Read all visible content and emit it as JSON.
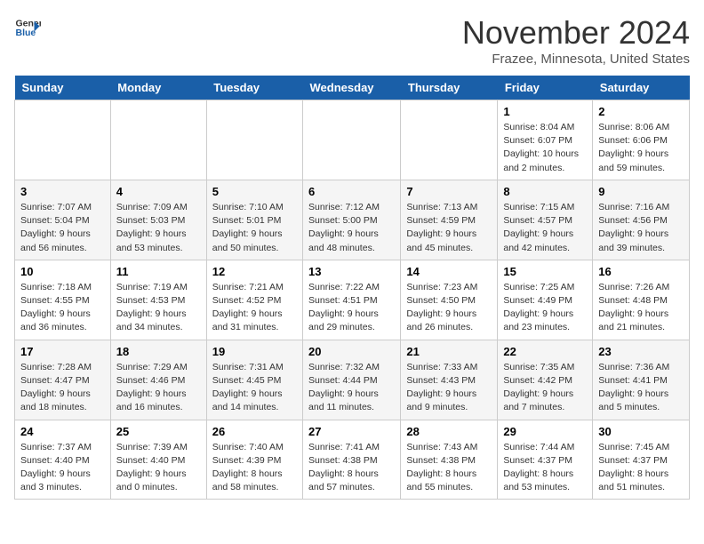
{
  "header": {
    "logo_line1": "General",
    "logo_line2": "Blue",
    "month_title": "November 2024",
    "subtitle": "Frazee, Minnesota, United States"
  },
  "weekdays": [
    "Sunday",
    "Monday",
    "Tuesday",
    "Wednesday",
    "Thursday",
    "Friday",
    "Saturday"
  ],
  "weeks": [
    [
      {
        "day": "",
        "info": ""
      },
      {
        "day": "",
        "info": ""
      },
      {
        "day": "",
        "info": ""
      },
      {
        "day": "",
        "info": ""
      },
      {
        "day": "",
        "info": ""
      },
      {
        "day": "1",
        "info": "Sunrise: 8:04 AM\nSunset: 6:07 PM\nDaylight: 10 hours\nand 2 minutes."
      },
      {
        "day": "2",
        "info": "Sunrise: 8:06 AM\nSunset: 6:06 PM\nDaylight: 9 hours\nand 59 minutes."
      }
    ],
    [
      {
        "day": "3",
        "info": "Sunrise: 7:07 AM\nSunset: 5:04 PM\nDaylight: 9 hours\nand 56 minutes."
      },
      {
        "day": "4",
        "info": "Sunrise: 7:09 AM\nSunset: 5:03 PM\nDaylight: 9 hours\nand 53 minutes."
      },
      {
        "day": "5",
        "info": "Sunrise: 7:10 AM\nSunset: 5:01 PM\nDaylight: 9 hours\nand 50 minutes."
      },
      {
        "day": "6",
        "info": "Sunrise: 7:12 AM\nSunset: 5:00 PM\nDaylight: 9 hours\nand 48 minutes."
      },
      {
        "day": "7",
        "info": "Sunrise: 7:13 AM\nSunset: 4:59 PM\nDaylight: 9 hours\nand 45 minutes."
      },
      {
        "day": "8",
        "info": "Sunrise: 7:15 AM\nSunset: 4:57 PM\nDaylight: 9 hours\nand 42 minutes."
      },
      {
        "day": "9",
        "info": "Sunrise: 7:16 AM\nSunset: 4:56 PM\nDaylight: 9 hours\nand 39 minutes."
      }
    ],
    [
      {
        "day": "10",
        "info": "Sunrise: 7:18 AM\nSunset: 4:55 PM\nDaylight: 9 hours\nand 36 minutes."
      },
      {
        "day": "11",
        "info": "Sunrise: 7:19 AM\nSunset: 4:53 PM\nDaylight: 9 hours\nand 34 minutes."
      },
      {
        "day": "12",
        "info": "Sunrise: 7:21 AM\nSunset: 4:52 PM\nDaylight: 9 hours\nand 31 minutes."
      },
      {
        "day": "13",
        "info": "Sunrise: 7:22 AM\nSunset: 4:51 PM\nDaylight: 9 hours\nand 29 minutes."
      },
      {
        "day": "14",
        "info": "Sunrise: 7:23 AM\nSunset: 4:50 PM\nDaylight: 9 hours\nand 26 minutes."
      },
      {
        "day": "15",
        "info": "Sunrise: 7:25 AM\nSunset: 4:49 PM\nDaylight: 9 hours\nand 23 minutes."
      },
      {
        "day": "16",
        "info": "Sunrise: 7:26 AM\nSunset: 4:48 PM\nDaylight: 9 hours\nand 21 minutes."
      }
    ],
    [
      {
        "day": "17",
        "info": "Sunrise: 7:28 AM\nSunset: 4:47 PM\nDaylight: 9 hours\nand 18 minutes."
      },
      {
        "day": "18",
        "info": "Sunrise: 7:29 AM\nSunset: 4:46 PM\nDaylight: 9 hours\nand 16 minutes."
      },
      {
        "day": "19",
        "info": "Sunrise: 7:31 AM\nSunset: 4:45 PM\nDaylight: 9 hours\nand 14 minutes."
      },
      {
        "day": "20",
        "info": "Sunrise: 7:32 AM\nSunset: 4:44 PM\nDaylight: 9 hours\nand 11 minutes."
      },
      {
        "day": "21",
        "info": "Sunrise: 7:33 AM\nSunset: 4:43 PM\nDaylight: 9 hours\nand 9 minutes."
      },
      {
        "day": "22",
        "info": "Sunrise: 7:35 AM\nSunset: 4:42 PM\nDaylight: 9 hours\nand 7 minutes."
      },
      {
        "day": "23",
        "info": "Sunrise: 7:36 AM\nSunset: 4:41 PM\nDaylight: 9 hours\nand 5 minutes."
      }
    ],
    [
      {
        "day": "24",
        "info": "Sunrise: 7:37 AM\nSunset: 4:40 PM\nDaylight: 9 hours\nand 3 minutes."
      },
      {
        "day": "25",
        "info": "Sunrise: 7:39 AM\nSunset: 4:40 PM\nDaylight: 9 hours\nand 0 minutes."
      },
      {
        "day": "26",
        "info": "Sunrise: 7:40 AM\nSunset: 4:39 PM\nDaylight: 8 hours\nand 58 minutes."
      },
      {
        "day": "27",
        "info": "Sunrise: 7:41 AM\nSunset: 4:38 PM\nDaylight: 8 hours\nand 57 minutes."
      },
      {
        "day": "28",
        "info": "Sunrise: 7:43 AM\nSunset: 4:38 PM\nDaylight: 8 hours\nand 55 minutes."
      },
      {
        "day": "29",
        "info": "Sunrise: 7:44 AM\nSunset: 4:37 PM\nDaylight: 8 hours\nand 53 minutes."
      },
      {
        "day": "30",
        "info": "Sunrise: 7:45 AM\nSunset: 4:37 PM\nDaylight: 8 hours\nand 51 minutes."
      }
    ]
  ]
}
